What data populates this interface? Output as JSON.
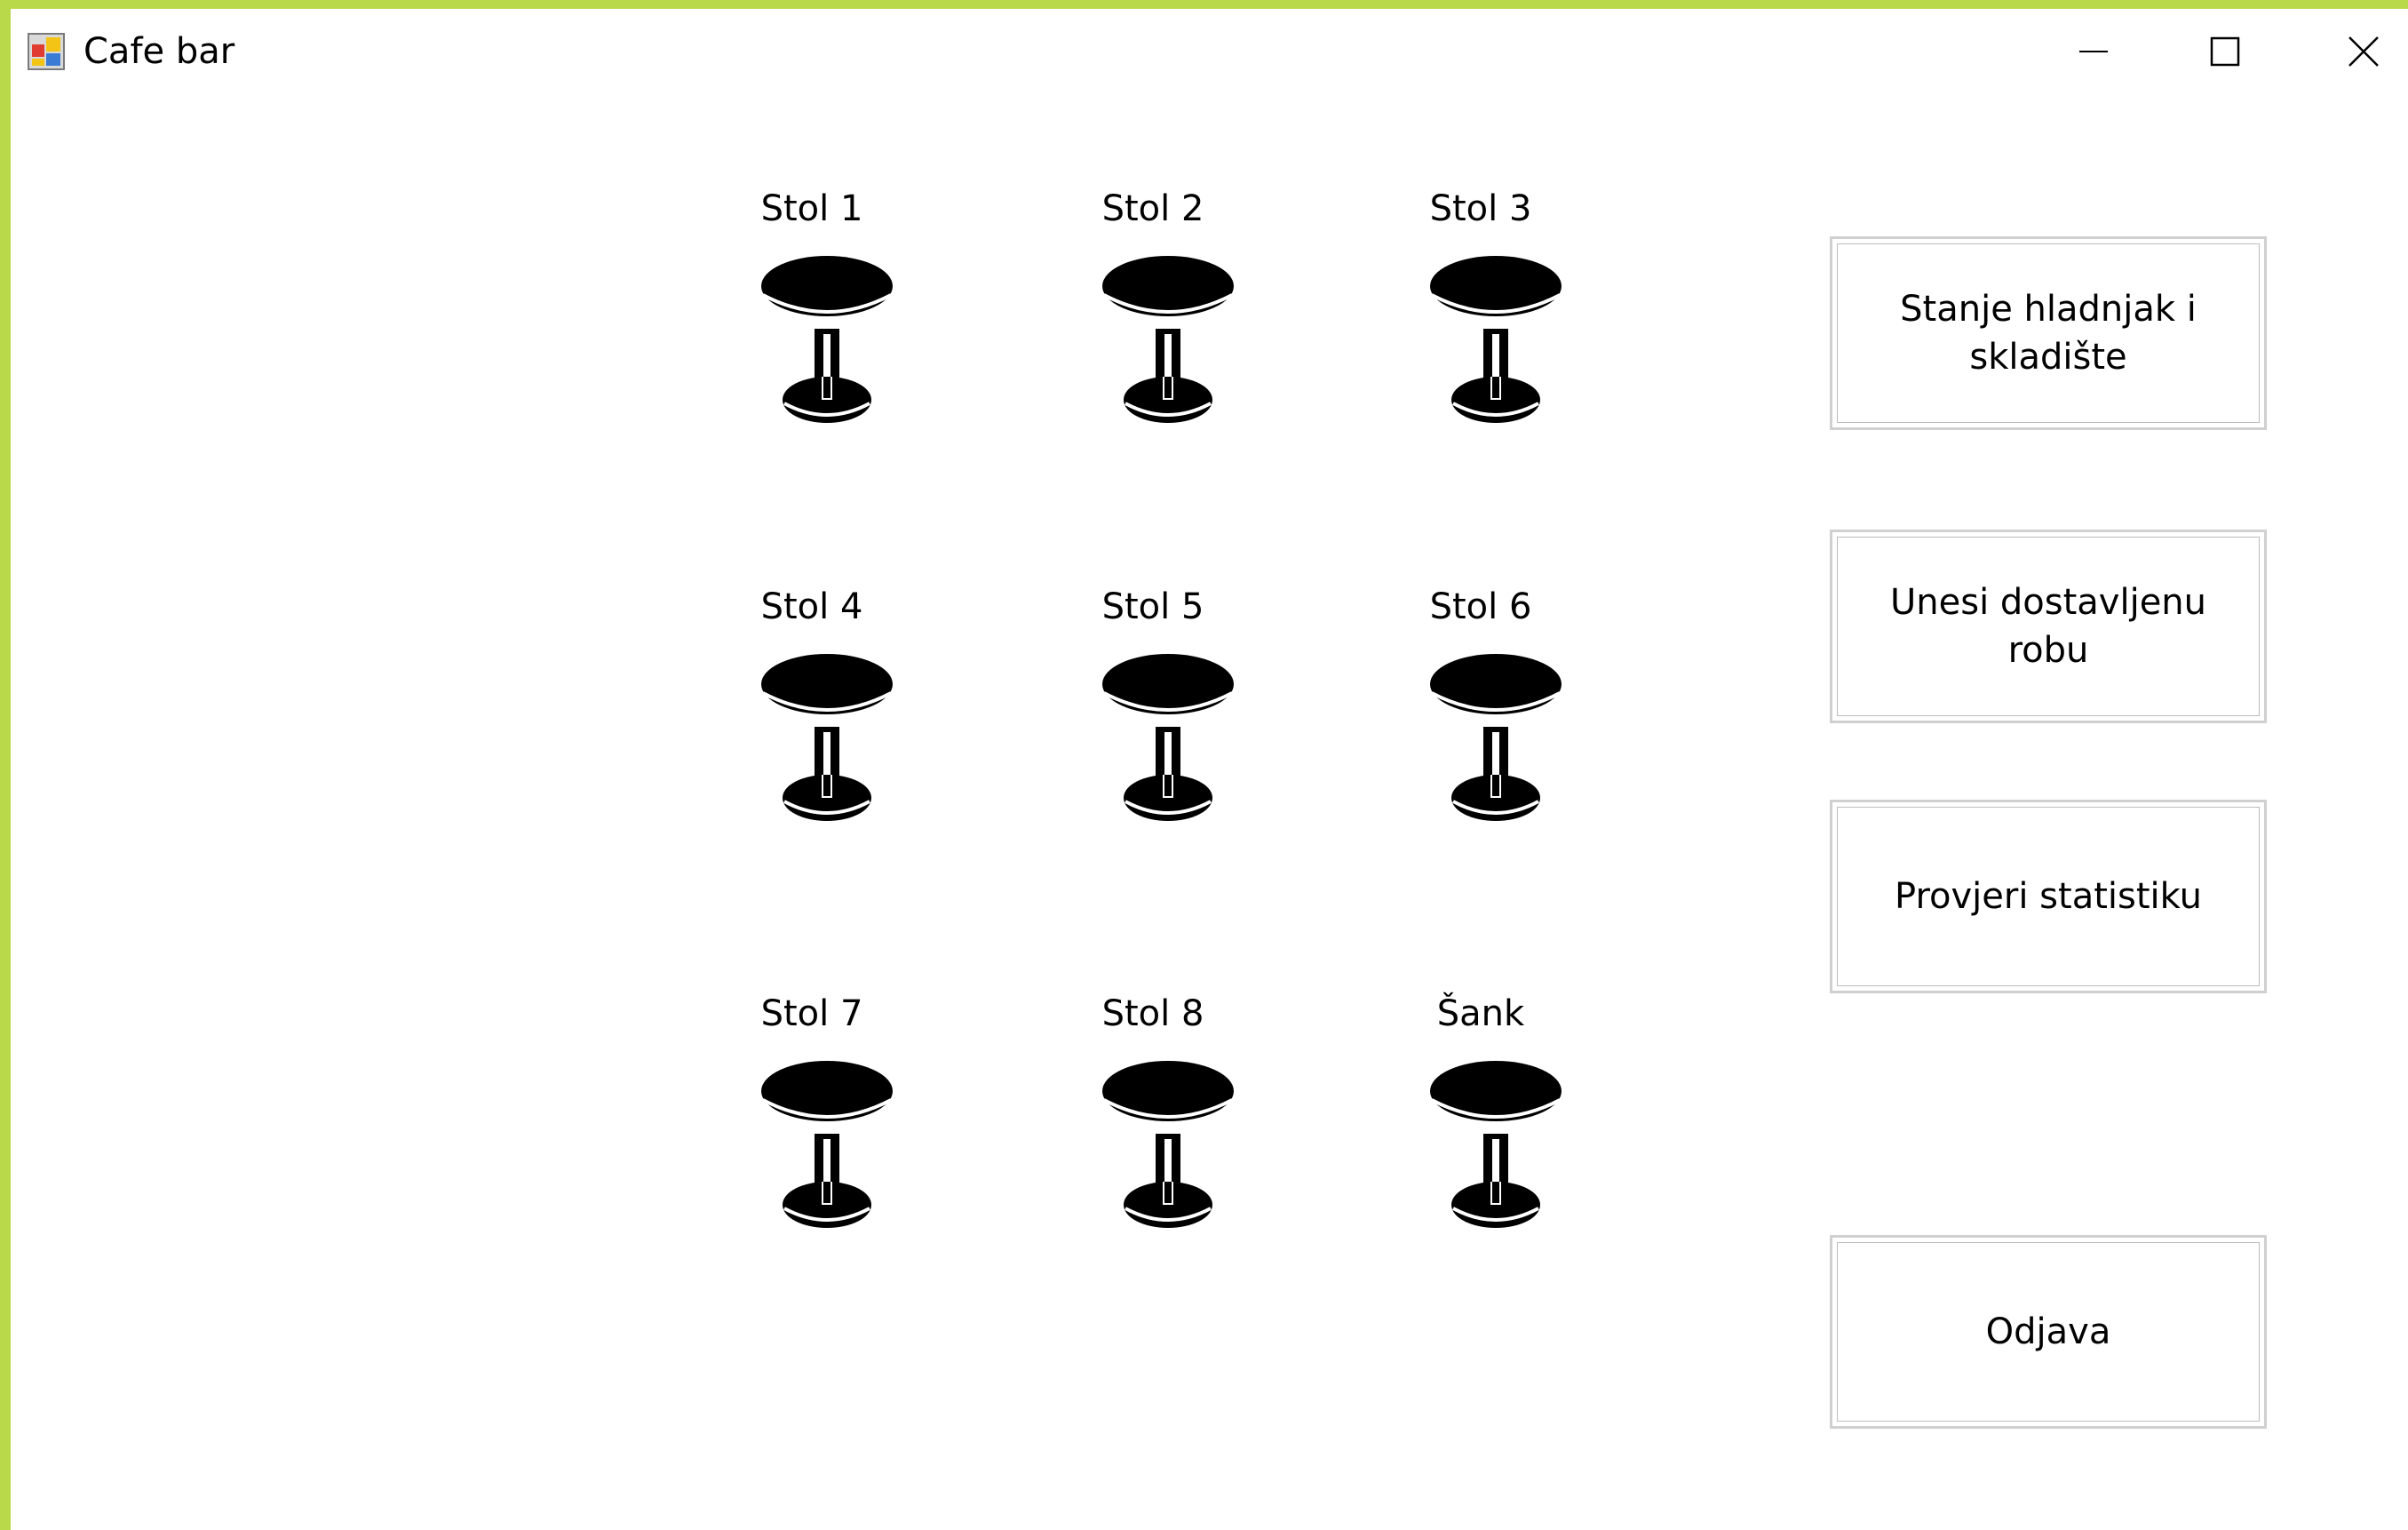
{
  "window": {
    "title": "Cafe bar",
    "controls": [
      "minimize-icon",
      "maximize-icon",
      "close-icon"
    ],
    "accent_color": "#b9d94a"
  },
  "tables": [
    {
      "label": "Stol 1",
      "icon": "bar-table-icon"
    },
    {
      "label": "Stol 2",
      "icon": "bar-table-icon"
    },
    {
      "label": "Stol 3",
      "icon": "bar-table-icon"
    },
    {
      "label": "Stol 4",
      "icon": "bar-table-icon"
    },
    {
      "label": "Stol 5",
      "icon": "bar-table-icon"
    },
    {
      "label": "Stol 6",
      "icon": "bar-table-icon"
    },
    {
      "label": "Stol 7",
      "icon": "bar-table-icon"
    },
    {
      "label": "Stol 8",
      "icon": "bar-table-icon"
    },
    {
      "label": "Šank",
      "icon": "bar-table-icon"
    }
  ],
  "actions": {
    "fridge_storage": "Stanje hladnjak i skladište",
    "enter_delivery": "Unesi dostavljenu robu",
    "statistics": "Provjeri statistiku",
    "logout": "Odjava"
  }
}
